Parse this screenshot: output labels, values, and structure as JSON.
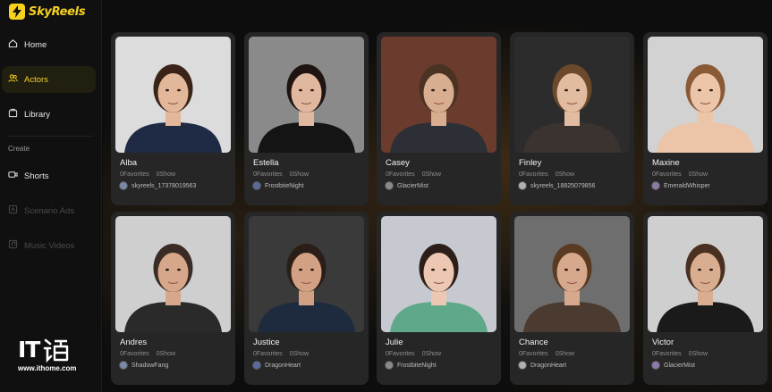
{
  "app": {
    "name": "SkyReels",
    "accent": "#f5d21f"
  },
  "sidebar": {
    "items": [
      {
        "label": "Home",
        "icon": "home-icon",
        "state": "normal"
      },
      {
        "label": "Actors",
        "icon": "users-icon",
        "state": "active"
      },
      {
        "label": "Library",
        "icon": "library-icon",
        "state": "normal"
      }
    ],
    "section_label": "Create",
    "create_items": [
      {
        "label": "Shorts",
        "icon": "film-icon",
        "state": "normal"
      },
      {
        "label": "Scenario Ads",
        "icon": "ads-icon",
        "state": "disabled"
      },
      {
        "label": "Music Videos",
        "icon": "music-icon",
        "state": "disabled"
      }
    ]
  },
  "watermark": {
    "logo_text": "IT",
    "url": "www.ithome.com"
  },
  "actors": [
    {
      "name": "Alba",
      "favorites": "0Favorites",
      "shows": "0Show",
      "owner": "skyreels_17378019563",
      "bg": "#dcdcdc",
      "skin": "#e2b79a",
      "hair": "#3a2418",
      "cloth": "#1f2a44"
    },
    {
      "name": "Estella",
      "favorites": "0Favorites",
      "shows": "0Show",
      "owner": "FrostbiteNight",
      "bg": "#8a8a8a",
      "skin": "#e0b8a0",
      "hair": "#1e1512",
      "cloth": "#141414"
    },
    {
      "name": "Casey",
      "favorites": "0Favorites",
      "shows": "0Show",
      "owner": "GlacierMist",
      "bg": "#6b3b2e",
      "skin": "#d9ad8f",
      "hair": "#4a3322",
      "cloth": "#2c2f35"
    },
    {
      "name": "Finley",
      "favorites": "0Favorites",
      "shows": "0Show",
      "owner": "skyreels_18825079856",
      "bg": "#2c2c2c",
      "skin": "#e1bca0",
      "hair": "#6b4a2c",
      "cloth": "#3a3330"
    },
    {
      "name": "Maxine",
      "favorites": "0Favorites",
      "shows": "0Show",
      "owner": "EmeraldWhisper",
      "bg": "#d2d2d2",
      "skin": "#ecc4a8",
      "hair": "#8a5a36",
      "cloth": "#ecc4a8"
    },
    {
      "name": "Andres",
      "favorites": "0Favorites",
      "shows": "0Show",
      "owner": "ShadowFang",
      "bg": "#cfcfcf",
      "skin": "#d6a78a",
      "hair": "#3a2c24",
      "cloth": "#2a2a2a"
    },
    {
      "name": "Justice",
      "favorites": "0Favorites",
      "shows": "0Show",
      "owner": "DragonHeart",
      "bg": "#3a3a3a",
      "skin": "#d2a184",
      "hair": "#2a1e18",
      "cloth": "#1e2a3e"
    },
    {
      "name": "Julie",
      "favorites": "0Favorites",
      "shows": "0Show",
      "owner": "FrostbiteNight",
      "bg": "#c6c9cf",
      "skin": "#ecc8b2",
      "hair": "#2c1e18",
      "cloth": "#5fa88a"
    },
    {
      "name": "Chance",
      "favorites": "0Favorites",
      "shows": "0Show",
      "owner": "DragonHeart",
      "bg": "#6e6e6e",
      "skin": "#d6a88c",
      "hair": "#5a3a22",
      "cloth": "#4a3a30"
    },
    {
      "name": "Victor",
      "favorites": "0Favorites",
      "shows": "0Show",
      "owner": "GlacierMist",
      "bg": "#cfcfcf",
      "skin": "#d9ae90",
      "hair": "#4a3020",
      "cloth": "#1a1a1a"
    }
  ]
}
